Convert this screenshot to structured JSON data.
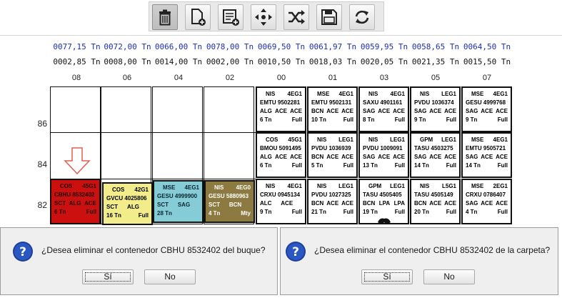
{
  "toolbar": {
    "buttons": [
      {
        "name": "delete-button",
        "icon": "trash-icon",
        "pressed": true
      },
      {
        "name": "new-document-button",
        "icon": "add-document-icon"
      },
      {
        "name": "list-add-button",
        "icon": "list-add-icon"
      },
      {
        "name": "move-button",
        "icon": "move-arrows-icon"
      },
      {
        "name": "shuffle-button",
        "icon": "shuffle-icon"
      },
      {
        "name": "save-button",
        "icon": "floppy-disk-icon"
      },
      {
        "name": "refresh-button",
        "icon": "refresh-icon"
      }
    ]
  },
  "weights_top": [
    "0077,15 Tn",
    "0072,00 Tn",
    "0066,00 Tn",
    "0078,00 Tn",
    "0069,50 Tn",
    "0061,97 Tn",
    "0059,95 Tn",
    "0058,65 Tn",
    "0064,50 Tn"
  ],
  "weights_bottom": [
    "0002,85 Tn",
    "0008,00 Tn",
    "0014,00 Tn",
    "0002,00 Tn",
    "0010,50 Tn",
    "0018,03 Tn",
    "0020,05 Tn",
    "0021,35 Tn",
    "0015,50 Tn"
  ],
  "bays": [
    "08",
    "06",
    "04",
    "02",
    "00",
    "01",
    "03",
    "05",
    "07"
  ],
  "tiers": [
    "86",
    "84",
    "82"
  ],
  "containers": {
    "c_00_86": {
      "pol": "NIS",
      "type": "4EG1",
      "id": "EMTU 9502281",
      "pod": "ALG",
      "s1": "ACE",
      "s2": "ACE",
      "weight": "6 Tn",
      "status": "Full"
    },
    "c_01_86": {
      "pol": "MSE",
      "type": "4EG1",
      "id": "EMTU 9502131",
      "pod": "BCN",
      "s1": "ACE",
      "s2": "ACE",
      "weight": "10 Tn",
      "status": "Full"
    },
    "c_03_86": {
      "pol": "NIS",
      "type": "4EG1",
      "id": "SAXU 4901161",
      "pod": "SAG",
      "s1": "ACE",
      "s2": "ACE",
      "weight": "8 Tn",
      "status": "Full"
    },
    "c_05_86": {
      "pol": "NIS",
      "type": "LEG1",
      "id": "PVDU 1036374",
      "pod": "SAG",
      "s1": "ACE",
      "s2": "ACE",
      "weight": "9 Tn",
      "status": "Full"
    },
    "c_07_86": {
      "pol": "MSE",
      "type": "4EG1",
      "id": "GESU 4999768",
      "pod": "SAG",
      "s1": "ACE",
      "s2": "ACE",
      "weight": "9 Tn",
      "status": "Full"
    },
    "c_00_84": {
      "pol": "COS",
      "type": "45G1",
      "id": "BMOU 5091495",
      "pod": "ALG",
      "s1": "ACE",
      "s2": "ACE",
      "weight": "6 Tn",
      "status": "Full"
    },
    "c_01_84": {
      "pol": "NIS",
      "type": "LEG1",
      "id": "PVDU 1036939",
      "pod": "BCN",
      "s1": "ACE",
      "s2": "ACE",
      "weight": "5 Tn",
      "status": "Full"
    },
    "c_03_84": {
      "pol": "NIS",
      "type": "LEG1",
      "id": "PVDU 1009091",
      "pod": "SAG",
      "s1": "ACE",
      "s2": "ACE",
      "weight": "13 Tn",
      "status": "Full"
    },
    "c_05_84": {
      "pol": "GPM",
      "type": "LEG1",
      "id": "TASU 4503275",
      "pod": "SAG",
      "s1": "ACE",
      "s2": "ACE",
      "weight": "14 Tn",
      "status": "Full"
    },
    "c_07_84": {
      "pol": "MSE",
      "type": "4EG1",
      "id": "EMTU 9505721",
      "pod": "SAG",
      "s1": "ACE",
      "s2": "ACE",
      "weight": "14 Tn",
      "status": "Full"
    },
    "c_08_82": {
      "pol": "COS",
      "type": "45G1",
      "id": "CBHU 8532402",
      "pod": "SCT",
      "s1": "ALG",
      "s2": "ACE",
      "weight": "6 Tn",
      "status": "Full"
    },
    "c_06_82": {
      "pol": "COS",
      "type": "42G1",
      "id": "GVCU 4025806",
      "pod": "SCT",
      "s1": "ALG",
      "s2": "",
      "weight": "16 Tn",
      "status": "Full"
    },
    "c_04_82": {
      "pol": "MSE",
      "type": "4EG1",
      "id": "GESU 4999900",
      "pod": "SCT",
      "s1": "SAG",
      "s2": "",
      "weight": "28 Tn",
      "status": "Full"
    },
    "c_02_82": {
      "pol": "NIS",
      "type": "4EG0",
      "id": "GESU 5880963",
      "pod": "SCT",
      "s1": "BCN",
      "s2": "",
      "weight": "4 Tn",
      "status": "Mty"
    },
    "c_00_82": {
      "pol": "NIS",
      "type": "4EG1",
      "id": "CRXU 0945134",
      "pod": "ALC",
      "s1": "ACE",
      "s2": "",
      "weight": "9 Tn",
      "status": "Full"
    },
    "c_01_82": {
      "pol": "NIS",
      "type": "LEG1",
      "id": "PVDU 1027325",
      "pod": "BCN",
      "s1": "ACE",
      "s2": "ACE",
      "weight": "21 Tn",
      "status": "Full"
    },
    "c_03_82": {
      "pol": "GPM",
      "type": "LEG1",
      "id": "TASU 4505405",
      "pod": "BCN",
      "s1": "LPA",
      "s2": "LPA",
      "weight": "19 Tn",
      "status": "Full"
    },
    "c_05_82": {
      "pol": "NIS",
      "type": "L5G1",
      "id": "TASU 4505149",
      "pod": "BCN",
      "s1": "ACE",
      "s2": "ACE",
      "weight": "20 Tn",
      "status": "Full"
    },
    "c_07_82": {
      "pol": "MSE",
      "type": "2EG1",
      "id": "CRXU 0786407",
      "pod": "SAG",
      "s1": "ACE",
      "s2": "ACE",
      "weight": "4 Tn",
      "status": "Full"
    }
  },
  "dialog_left": {
    "message": "¿Desea eliminar el contenedor  CBHU 8532402 del buque?",
    "yes": "Sí",
    "no": "No"
  },
  "dialog_right": {
    "message": "¿Desea eliminar el contenedor CBHU 8532402 de la carpeta?",
    "yes": "Sí",
    "no": "No"
  }
}
